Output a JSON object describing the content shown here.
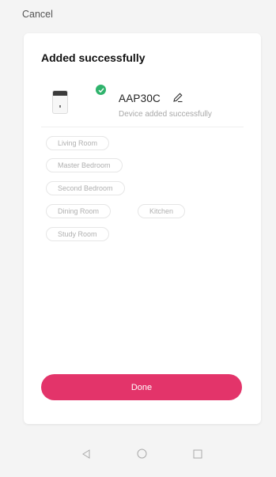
{
  "header": {
    "cancel_label": "Cancel"
  },
  "card": {
    "title": "Added successfully",
    "device": {
      "name": "AAP30C",
      "status": "Device added successfully",
      "badge_color": "#2fb36c"
    },
    "rooms": [
      "Living Room",
      "Master Bedroom",
      "Second Bedroom",
      "Dining Room",
      "Kitchen",
      "Study Room"
    ],
    "done_label": "Done",
    "accent": "#e3346a"
  },
  "navbar": {
    "icons": [
      "back-icon",
      "home-icon",
      "recents-icon"
    ]
  }
}
